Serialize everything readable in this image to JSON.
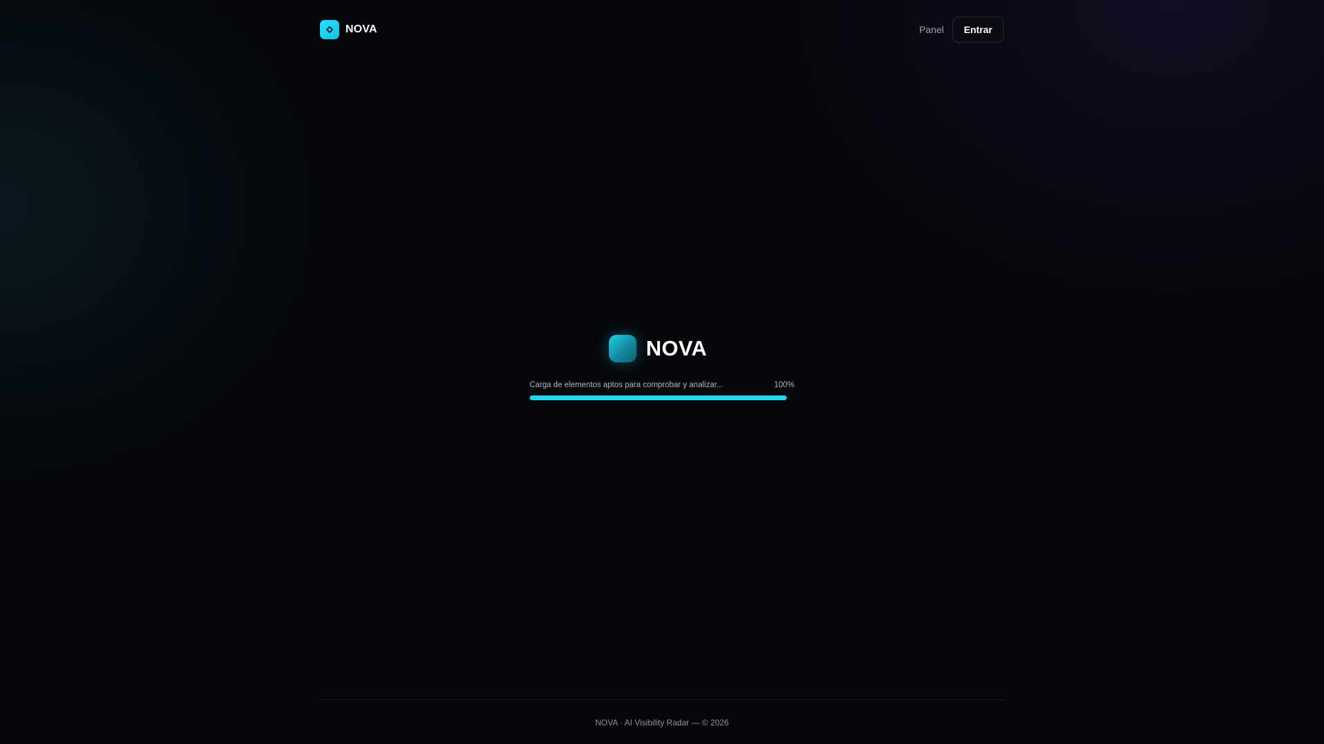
{
  "header": {
    "brand_name": "NOVA",
    "nav": {
      "panel_label": "Panel",
      "login_label": "Entrar"
    }
  },
  "loader": {
    "brand_name": "NOVA",
    "status_text": "Carga de elementos aptos para comprobar y analizar...",
    "progress_label": "100%",
    "progress_value": 100
  },
  "footer": {
    "text": "NOVA · AI Visibility Radar — © 2026"
  },
  "colors": {
    "accent": "#22d3ee",
    "background": "#05060a"
  },
  "icons": {
    "brand": "diamond-icon"
  }
}
